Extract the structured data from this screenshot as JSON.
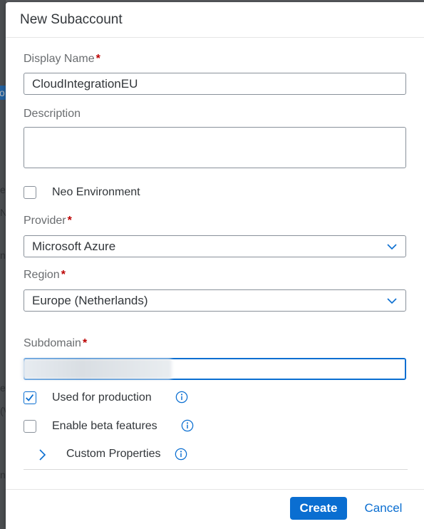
{
  "background": {
    "left_fragments": [
      "o",
      "e",
      "N",
      "ne",
      "e",
      "(V",
      "ne"
    ]
  },
  "dialog": {
    "title": "New Subaccount"
  },
  "form": {
    "display_name": {
      "label": "Display Name",
      "required_mark": "*",
      "value": "CloudIntegrationEU"
    },
    "description": {
      "label": "Description",
      "value": ""
    },
    "neo_environment": {
      "label": "Neo Environment",
      "checked": false
    },
    "provider": {
      "label": "Provider",
      "required_mark": "*",
      "value": "Microsoft Azure"
    },
    "region": {
      "label": "Region",
      "required_mark": "*",
      "value": "Europe (Netherlands)"
    },
    "subdomain": {
      "label": "Subdomain",
      "required_mark": "*"
    },
    "used_for_production": {
      "label": "Used for production",
      "checked": true
    },
    "enable_beta": {
      "label": "Enable beta features",
      "checked": false
    },
    "custom_properties": {
      "label": "Custom Properties"
    }
  },
  "footer": {
    "create_label": "Create",
    "cancel_label": "Cancel"
  },
  "colors": {
    "accent": "#0a6ed1",
    "required": "#bb0000",
    "text": "#32363a"
  }
}
